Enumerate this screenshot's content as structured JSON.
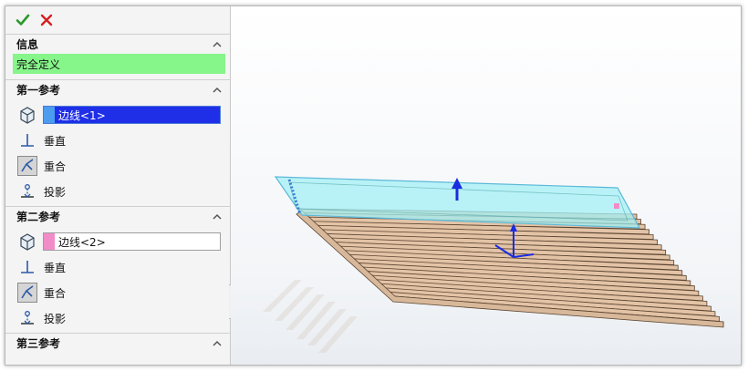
{
  "toolbar": {
    "ok_icon": "green-check-icon",
    "cancel_icon": "red-x-icon"
  },
  "info": {
    "title": "信息",
    "status": "完全定义",
    "status_color": "#86f58a"
  },
  "first_ref": {
    "title": "第一参考",
    "field_value": "边线<1>",
    "swatch_color": "#4c9cf0",
    "options": [
      {
        "label": "垂直",
        "icon": "perpendicular-icon",
        "selected": false
      },
      {
        "label": "重合",
        "icon": "coincident-icon",
        "selected": true
      },
      {
        "label": "投影",
        "icon": "projection-icon",
        "selected": false
      }
    ]
  },
  "second_ref": {
    "title": "第二参考",
    "field_value": "边线<2>",
    "swatch_color": "#f28cc8",
    "options": [
      {
        "label": "垂直",
        "icon": "perpendicular-icon",
        "selected": false
      },
      {
        "label": "重合",
        "icon": "coincident-icon",
        "selected": true
      },
      {
        "label": "投影",
        "icon": "projection-icon",
        "selected": false
      }
    ]
  },
  "third_ref": {
    "title": "第三参考"
  },
  "colors": {
    "plane_fill": "#9ff0f5",
    "plane_edge": "#5bb8d8",
    "slat_fill": "#e3c3a6",
    "slat_edge": "#5a4430"
  }
}
